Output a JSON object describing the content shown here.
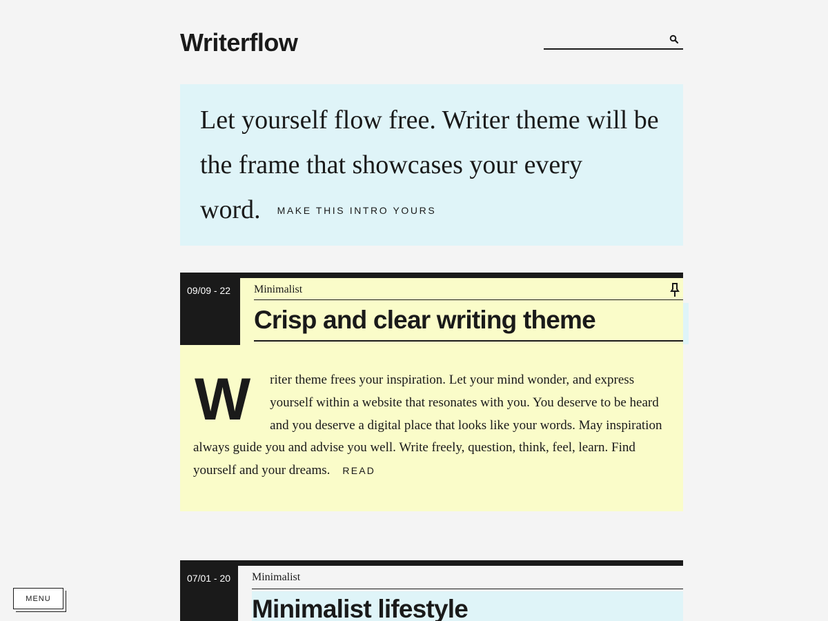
{
  "site": {
    "title": "Writerflow"
  },
  "search": {
    "placeholder": ""
  },
  "intro": {
    "text": "Let yourself flow free. Writer theme will be the frame that showcases your every word.",
    "link": "MAKE THIS INTRO YOURS"
  },
  "posts": [
    {
      "date": "09/09 - 22",
      "category": "Minimalist",
      "title": "Crisp and clear writing theme",
      "dropcap": "W",
      "excerpt": "riter theme frees your inspiration. Let your mind wonder, and express yourself within a website that resonates with you. You deserve to be heard and you deserve a digital place that looks like your words. May inspiration always guide you and advise you well. Write freely, question, think, feel, learn. Find yourself and your dreams.",
      "read_link": "READ",
      "pinned": true
    },
    {
      "date": "07/01 - 20",
      "category": "Minimalist",
      "title": "Minimalist lifestyle"
    }
  ],
  "menu": {
    "label": "MENU"
  },
  "colors": {
    "background": "#f4f4f4",
    "intro_bg": "#dff4f8",
    "post_bg": "#fafcc9",
    "ink": "#1a1a1a"
  }
}
